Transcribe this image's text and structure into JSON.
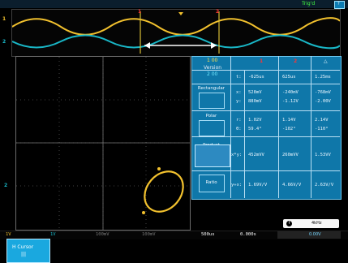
{
  "top_bar": {
    "trigger_status": "Trig'd",
    "right_label": "?"
  },
  "markers": {
    "cursor_a": "1",
    "cursor_b": "2",
    "waveform_bottom": "1",
    "left_ch1": "1",
    "left_ch2": "2",
    "xy_left": "2"
  },
  "cursor_panel": {
    "source_label": "1 00",
    "version_label": "Version",
    "version_value": "2 00",
    "col1": "1",
    "col2": "2",
    "col_delta": "△",
    "rows": [
      {
        "name": "",
        "axis": "t:",
        "v1": "-625us",
        "v2": "625us",
        "dv": "1.25ms"
      },
      {
        "name": "Rectangular",
        "axis": "x:",
        "v1": "528mV",
        "v2": "-240mV",
        "dv": "-768mV"
      },
      {
        "name": "",
        "axis": "y:",
        "v1": "880mV",
        "v2": "-1.12V",
        "dv": "-2.00V"
      },
      {
        "name": "Polar",
        "axis": "r:",
        "v1": "1.02V",
        "v2": "1.14V",
        "dv": "2.14V"
      },
      {
        "name": "",
        "axis": "θ:",
        "v1": "59.4°",
        "v2": "-102°",
        "dv": "-110°"
      },
      {
        "name": "Product",
        "axis": "x*y:",
        "v1": "452mVV",
        "v2": "260mVV",
        "dv": "1.53VV"
      },
      {
        "name": "Ratio",
        "axis": "y÷x:",
        "v1": "1.69V/V",
        "v2": "4.66V/V",
        "dv": "2.63V/V"
      }
    ]
  },
  "bottom_bar": {
    "ch1_scale": "1V",
    "ch2_scale": "1V",
    "ch3_scale": "100mV",
    "ch4_scale": "100mV",
    "timebase": "500us",
    "position": "0.000s",
    "frequency": "4kHz",
    "trigger_level": "0.00V",
    "frequency_prefix": "f",
    "note": "0.00V"
  },
  "softkey": {
    "label": "H Cursor",
    "value": "|||"
  },
  "colors": {
    "ch1": "#f2c12e",
    "ch2": "#19b7c7",
    "cursor": "#ff2a2a",
    "panel": "#0e6ea4"
  }
}
